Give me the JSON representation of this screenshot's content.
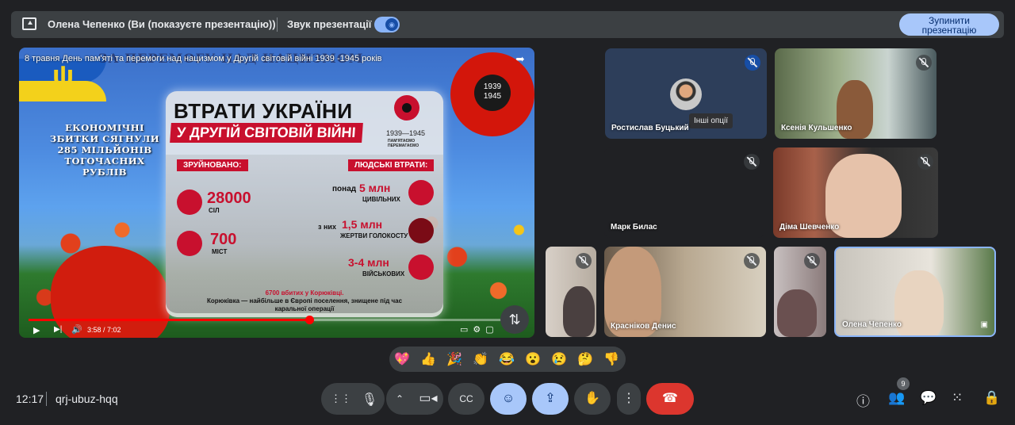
{
  "topbar": {
    "presenter": "Олена Чепенко (Ви (показуєте презентацію))",
    "sound_label": "Звук презентації",
    "stop_button": "Зупинити презентацію"
  },
  "presentation": {
    "video_title": "8 травня День пам'яті та перемоги над нацизмом у Другій світовій війні 1939 -1945 років",
    "banner_bg": "ЗА ПЕРЕМОГУ НАД НАЦИЗМОМ",
    "econ_text": "ЕКОНОМІЧНІ ЗБИТКИ СЯГНУЛИ 285 МІЛЬЙОНІВ ТОГОЧАСНИХ РУБЛІВ",
    "badge_years": "1939 1945",
    "card": {
      "title_line1": "ВТРАТИ УКРАЇНИ",
      "title_line2": "У ДРУГІЙ СВІТОВІЙ ВІЙНІ",
      "years": "1939—1945",
      "remember": "ПАМ'ЯТАЄМО ПЕРЕМАГАЄМО",
      "destroyed_label": "ЗРУЙНОВАНО:",
      "losses_label": "ЛЮДСЬКІ ВТРАТИ:",
      "villages_num": "28000",
      "villages_sub": "СІЛ",
      "cities_num": "700",
      "cities_sub": "МІСТ",
      "civil_pre": "понад",
      "civil_num": "5 млн",
      "civil_sub": "ЦИВІЛЬНИХ",
      "holo_pre": "з них",
      "holo_num": "1,5 млн",
      "holo_sub": "ЖЕРТВИ ГОЛОКОСТУ",
      "mil_num": "3-4 млн",
      "mil_sub": "ВІЙСЬКОВИХ",
      "foot_red": "6700 вбитих у Корюківці.",
      "foot_bold": "Корюківка",
      "foot_rest": " — найбільше в Європі поселення, знищене під час каральної операції"
    },
    "player": {
      "time": "3:58 / 7:02",
      "progress_fraction": 0.565
    }
  },
  "participants": [
    {
      "name": "Ростислав Буцький",
      "tooltip": "Інші опції"
    },
    {
      "name": "Ксенія Кульшенко"
    },
    {
      "name": "Марк Билас"
    },
    {
      "name": "Діма Шевченко"
    },
    {
      "name": ""
    },
    {
      "name": "Красніков Денис"
    },
    {
      "name": ""
    },
    {
      "name": "Олена Чепенко"
    }
  ],
  "reactions": [
    "💖",
    "👍",
    "🎉",
    "👏",
    "😂",
    "😮",
    "😢",
    "🤔",
    "👎"
  ],
  "bottom": {
    "clock": "12:17",
    "meeting_code": "qrj-ubuz-hqq",
    "people_count": "9"
  },
  "colors": {
    "accent": "#a8c7fa",
    "end_call": "#dc362e",
    "background": "#202124"
  }
}
